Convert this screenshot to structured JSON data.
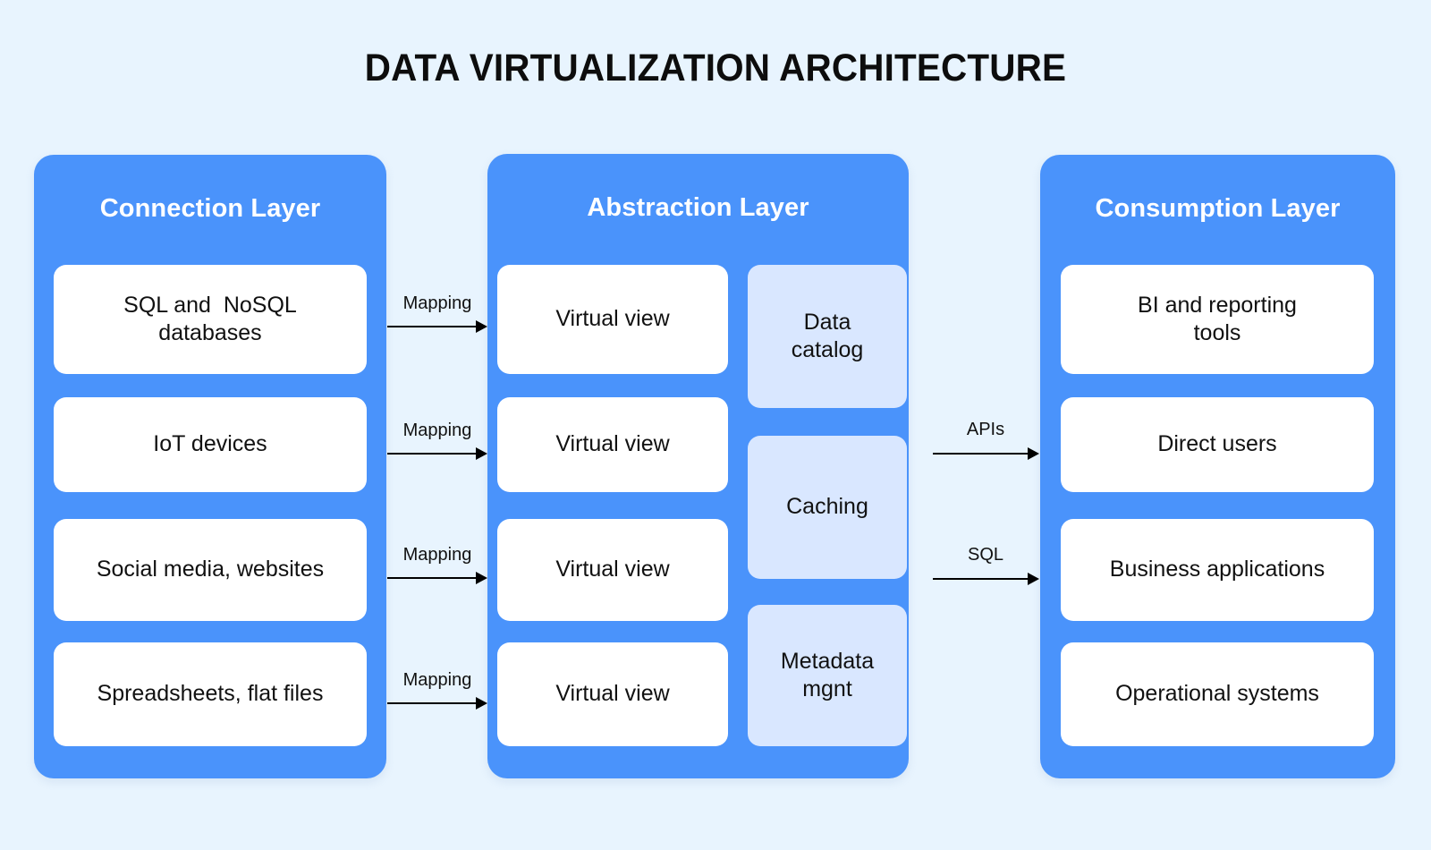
{
  "page": {
    "title": "DATA VIRTUALIZATION ARCHITECTURE",
    "background_color": "#e8f4fe"
  },
  "colors": {
    "panel_blue": "#4a93fb",
    "card_white": "#ffffff",
    "card_tinted": "#d9e7ff",
    "text_dark": "#111111",
    "text_light": "#ffffff",
    "arrow": "#000000"
  },
  "layers": [
    {
      "id": "connection",
      "title": "Connection Layer",
      "cards": [
        {
          "label": "SQL and  NoSQL\ndatabases",
          "style": "white"
        },
        {
          "label": "IoT devices",
          "style": "white"
        },
        {
          "label": "Social media, websites",
          "style": "white"
        },
        {
          "label": "Spreadsheets, flat files",
          "style": "white"
        }
      ]
    },
    {
      "id": "abstraction",
      "title": "Abstraction Layer",
      "cards": [
        {
          "label": "Virtual view",
          "style": "white"
        },
        {
          "label": "Virtual view",
          "style": "white"
        },
        {
          "label": "Virtual view",
          "style": "white"
        },
        {
          "label": "Virtual view",
          "style": "white"
        }
      ],
      "services": [
        {
          "label": "Data\ncatalog",
          "style": "tinted"
        },
        {
          "label": "Caching",
          "style": "tinted"
        },
        {
          "label": "Metadata\nmgnt",
          "style": "tinted"
        }
      ]
    },
    {
      "id": "consumption",
      "title": "Consumption Layer",
      "cards": [
        {
          "label": "BI and reporting\ntools",
          "style": "white"
        },
        {
          "label": "Direct users",
          "style": "white"
        },
        {
          "label": "Business applications",
          "style": "white"
        },
        {
          "label": "Operational systems",
          "style": "white"
        }
      ]
    }
  ],
  "connectors": {
    "mapping": [
      {
        "label": "Mapping",
        "from": "SQL and  NoSQL databases",
        "to": "Virtual view"
      },
      {
        "label": "Mapping",
        "from": "IoT devices",
        "to": "Virtual view"
      },
      {
        "label": "Mapping",
        "from": "Social media, websites",
        "to": "Virtual view"
      },
      {
        "label": "Mapping",
        "from": "Spreadsheets, flat files",
        "to": "Virtual view"
      }
    ],
    "output": [
      {
        "label": "APIs",
        "from": "Abstraction Layer",
        "to": "Direct users"
      },
      {
        "label": "SQL",
        "from": "Abstraction Layer",
        "to": "Business applications"
      }
    ]
  }
}
